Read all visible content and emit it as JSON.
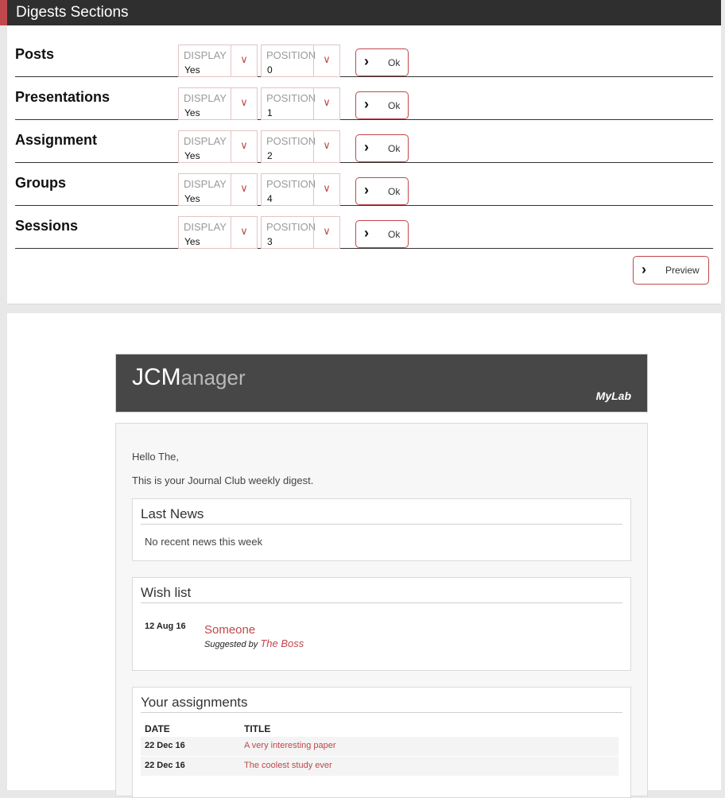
{
  "digests": {
    "header_title": "Digests Sections",
    "display_label": "DISPLAY",
    "position_label": "POSITION",
    "ok_label": "Ok",
    "preview_label": "Preview",
    "sections": [
      {
        "name": "Posts",
        "display": "Yes",
        "position": "0"
      },
      {
        "name": "Presentations",
        "display": "Yes",
        "position": "1"
      },
      {
        "name": "Assignment",
        "display": "Yes",
        "position": "2"
      },
      {
        "name": "Groups",
        "display": "Yes",
        "position": "4"
      },
      {
        "name": "Sessions",
        "display": "Yes",
        "position": "3"
      }
    ]
  },
  "email": {
    "brand_main": "JCM",
    "brand_rest": "anager",
    "lab_name": "MyLab",
    "greeting": "Hello The,",
    "intro": "This is your Journal Club weekly digest.",
    "last_news": {
      "title": "Last News",
      "empty_text": "No recent news this week"
    },
    "wish_list": {
      "title": "Wish list",
      "items": [
        {
          "date": "12 Aug 16",
          "title": "Someone",
          "suggested_prefix": "Suggested by",
          "suggested_by": "The Boss"
        }
      ]
    },
    "assignments": {
      "title": "Your assignments",
      "col_date": "DATE",
      "col_title": "TITLE",
      "rows": [
        {
          "date": "22 Dec 16",
          "title": "A very interesting paper"
        },
        {
          "date": "22 Dec 16",
          "title": "The coolest study ever"
        }
      ]
    }
  },
  "colors": {
    "accent": "#c0474b",
    "header_dark": "#2f2f2f",
    "banner": "#474747"
  },
  "icons": {
    "chevron_right": "chevron-right-icon",
    "chevron_down": "chevron-down-icon"
  }
}
